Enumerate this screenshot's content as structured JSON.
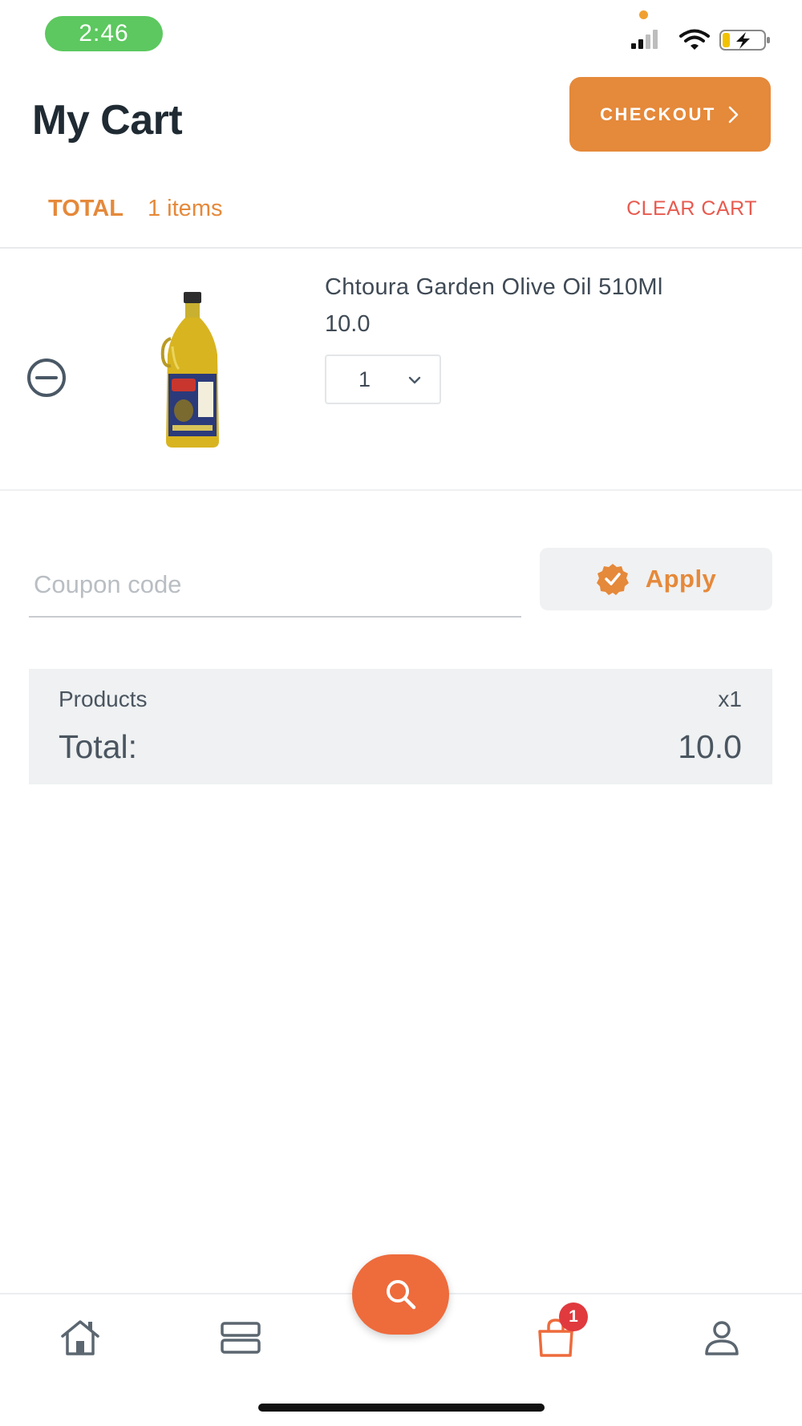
{
  "status_bar": {
    "time": "2:46"
  },
  "header": {
    "title": "My Cart",
    "checkout_label": "CHECKOUT"
  },
  "totals_bar": {
    "total_label": "TOTAL",
    "items_count": "1 items",
    "clear_cart_label": "CLEAR CART"
  },
  "cart": {
    "items": [
      {
        "name": "Chtoura Garden Olive Oil 510Ml",
        "price": "10.0",
        "quantity": "1"
      }
    ]
  },
  "coupon": {
    "placeholder": "Coupon code",
    "apply_label": "Apply"
  },
  "summary": {
    "products_label": "Products",
    "products_count": "x1",
    "total_label": "Total:",
    "total_value": "10.0"
  },
  "bottom_nav": {
    "cart_badge": "1",
    "items": [
      "home-icon",
      "categories-icon",
      "search-icon",
      "cart-icon",
      "profile-icon"
    ]
  },
  "colors": {
    "accent": "#e5893a",
    "danger": "#e85a4f",
    "fab": "#ee6b3c",
    "badge": "#e03a3e",
    "time_pill": "#5cc85f"
  }
}
